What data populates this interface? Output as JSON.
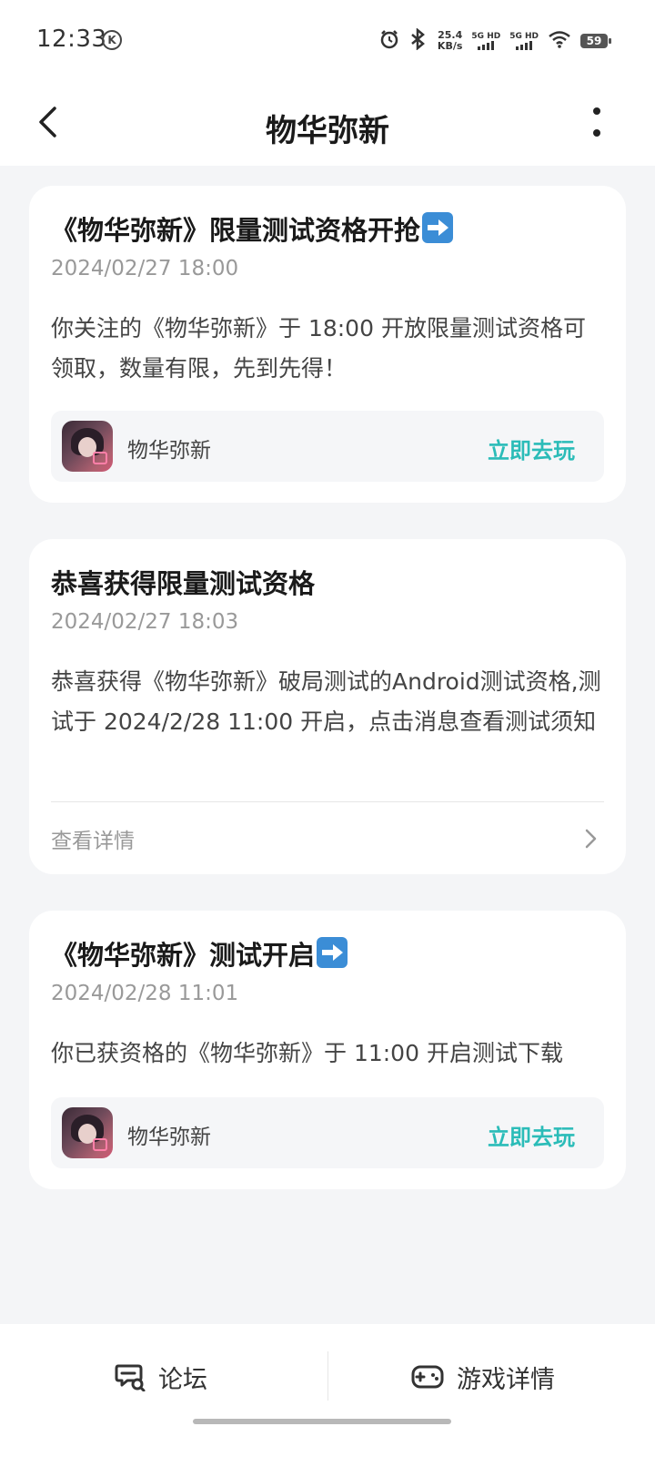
{
  "status_bar": {
    "time": "12:33",
    "time_badge": "K",
    "net_speed_value": "25.4",
    "net_speed_unit": "KB/s",
    "sim1_label": "5G HD",
    "sim2_label": "5G HD",
    "battery": "59",
    "icons": [
      "alarm-icon",
      "bluetooth-icon",
      "signal-icon",
      "wifi-icon",
      "battery-icon"
    ]
  },
  "header": {
    "title": "物华弥新",
    "back_icon": "chevron-left-icon",
    "more_icon": "more-vertical-icon"
  },
  "messages": [
    {
      "title": "《物华弥新》限量测试资格开抢",
      "title_emoji": "right-arrow-emoji",
      "date": "2024/02/27 18:00",
      "body": "你关注的《物华弥新》于 18:00 开放限量测试资格可领取，数量有限，先到先得！",
      "game": {
        "name": "物华弥新",
        "action": "立即去玩"
      }
    },
    {
      "title": "恭喜获得限量测试资格",
      "date": "2024/02/27 18:03",
      "body": "恭喜获得《物华弥新》破局测试的Android测试资格,测试于 2024/2/28 11:00 开启，点击消息查看测试须知",
      "link_label": "查看详情"
    },
    {
      "title": "《物华弥新》测试开启",
      "title_emoji": "right-arrow-emoji",
      "date": "2024/02/28 11:01",
      "body": "你已获资格的《物华弥新》于 11:00 开启测试下载",
      "game": {
        "name": "物华弥新",
        "action": "立即去玩"
      }
    }
  ],
  "bottom_bar": {
    "forum_label": "论坛",
    "game_detail_label": "游戏详情"
  },
  "colors": {
    "accent": "#2bbcb8",
    "background": "#f4f5f7",
    "card": "#ffffff",
    "muted_text": "#999999"
  }
}
